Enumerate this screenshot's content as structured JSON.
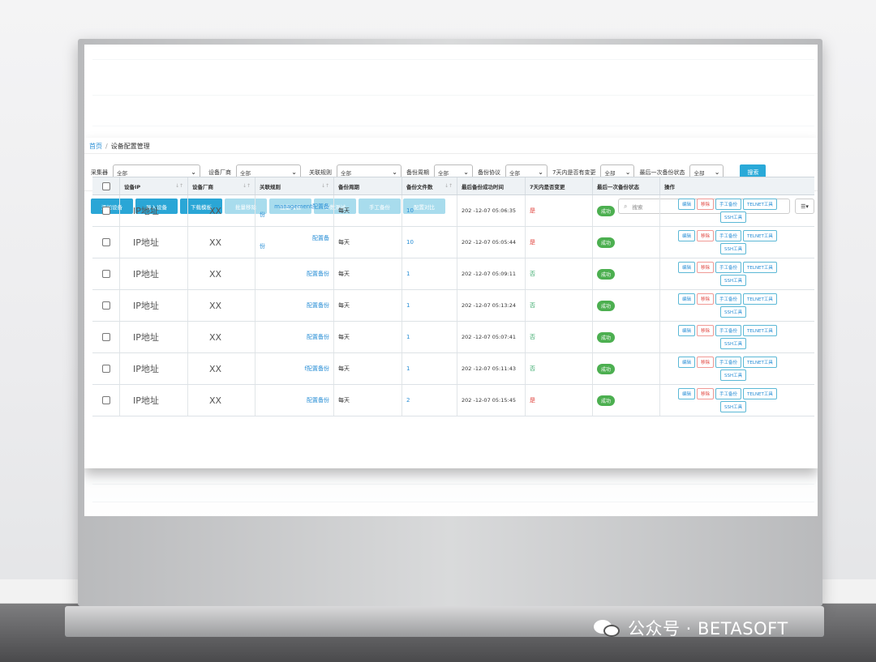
{
  "breadcrumb": {
    "home": "首页",
    "sep": "/",
    "current": "设备配置管理"
  },
  "filters": [
    {
      "label": "采集器",
      "value": "全部"
    },
    {
      "label": "设备厂商",
      "value": "全部"
    },
    {
      "label": "关联规则",
      "value": "全部"
    },
    {
      "label": "备份周期",
      "value": "全部"
    },
    {
      "label": "备份协议",
      "value": "全部"
    },
    {
      "label": "7天内是否有变更",
      "value": "全部"
    },
    {
      "label": "最后一次备份状态",
      "value": "全部"
    }
  ],
  "search_button": "搜索",
  "toolbar": [
    {
      "label": "添加设备",
      "enabled": true
    },
    {
      "label": "导入设备",
      "enabled": true
    },
    {
      "label": "下载模板",
      "enabled": true
    },
    {
      "label": "批量移除",
      "enabled": false
    },
    {
      "label": "批量编辑",
      "enabled": false
    },
    {
      "label": "参数测试",
      "enabled": false
    },
    {
      "label": "手工备份",
      "enabled": false
    },
    {
      "label": "配置对比",
      "enabled": false
    }
  ],
  "table_search_placeholder": "搜索",
  "columns_button": "▾",
  "columns": [
    "设备IP",
    "设备厂商",
    "关联规则",
    "备份周期",
    "备份文件数",
    "最后备份成功时间",
    "7天内是否变更",
    "最后一次备份状态",
    "操作"
  ],
  "rows": [
    {
      "ip": "IP地址",
      "vendor": "XX",
      "rule1": "management配置备",
      "rule2": "份",
      "period": "每天",
      "files": "10",
      "time": "202 -12-07 05:06:35",
      "changed": "是",
      "status": "成功"
    },
    {
      "ip": "IP地址",
      "vendor": "XX",
      "rule1": "配置备",
      "rule2": "份",
      "period": "每天",
      "files": "10",
      "time": "202 -12-07 05:05:44",
      "changed": "是",
      "status": "成功"
    },
    {
      "ip": "IP地址",
      "vendor": "XX",
      "rule1": "配置备份",
      "rule2": "",
      "period": "每天",
      "files": "1",
      "time": "202 -12-07 05:09:11",
      "changed": "否",
      "status": "成功"
    },
    {
      "ip": "IP地址",
      "vendor": "XX",
      "rule1": "配置备份",
      "rule2": "",
      "period": "每天",
      "files": "1",
      "time": "202 -12-07 05:13:24",
      "changed": "否",
      "status": "成功"
    },
    {
      "ip": "IP地址",
      "vendor": "XX",
      "rule1": "配置备份",
      "rule2": "",
      "period": "每天",
      "files": "1",
      "time": "202 -12-07 05:07:41",
      "changed": "否",
      "status": "成功"
    },
    {
      "ip": "IP地址",
      "vendor": "XX",
      "rule1": "f配置备份",
      "rule2": "",
      "period": "每天",
      "files": "1",
      "time": "202 -12-07 05:11:43",
      "changed": "否",
      "status": "成功"
    },
    {
      "ip": "IP地址",
      "vendor": "XX",
      "rule1": "配置备份",
      "rule2": "",
      "period": "每天",
      "files": "2",
      "time": "202 -12-07 05:15:45",
      "changed": "是",
      "status": "成功"
    }
  ],
  "row_actions": {
    "edit": "编辑",
    "delete": "移除",
    "manual_backup": "手工备份",
    "telnet": "TELNET工具",
    "ssh": "SSH工具"
  },
  "watermark": "公众号 · BETASOFT",
  "colors": {
    "primary": "#2aa6d6",
    "primary_disabled": "#a8dced",
    "success": "#4caf50",
    "danger": "#e0413b",
    "no": "#3aa96b"
  }
}
